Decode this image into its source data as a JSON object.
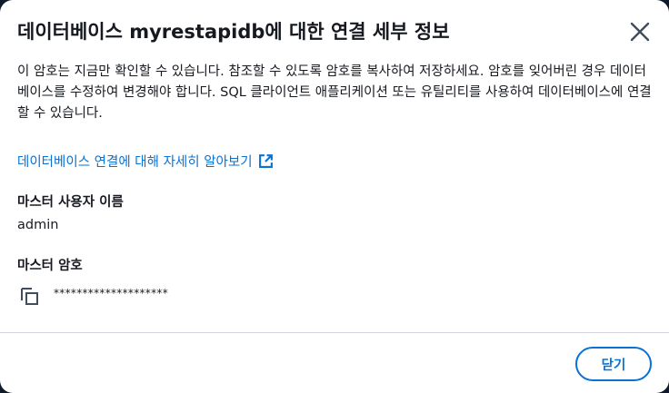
{
  "dialog": {
    "title": "데이터베이스 myrestapidb에 대한 연결 세부 정보",
    "description": "이 암호는 지금만 확인할 수 있습니다. 참조할 수 있도록 암호를 복사하여 저장하세요. 암호를 잊어버린 경우 데이터베이스를 수정하여 변경해야 합니다. SQL 클라이언트 애플리케이션 또는 유틸리티를 사용하여 데이터베이스에 연결할 수 있습니다.",
    "learn_more_link": "데이터베이스 연결에 대해 자세히 알아보기",
    "master_username_label": "마스터 사용자 이름",
    "master_username_value": "admin",
    "master_password_label": "마스터 암호",
    "master_password_value": "********************",
    "close_button_label": "닫기"
  },
  "colors": {
    "link": "#0972d3",
    "text": "#16191f",
    "divider": "#d1d5db"
  },
  "icons": {
    "close": "close-icon",
    "external": "external-link-icon",
    "copy": "copy-icon"
  }
}
